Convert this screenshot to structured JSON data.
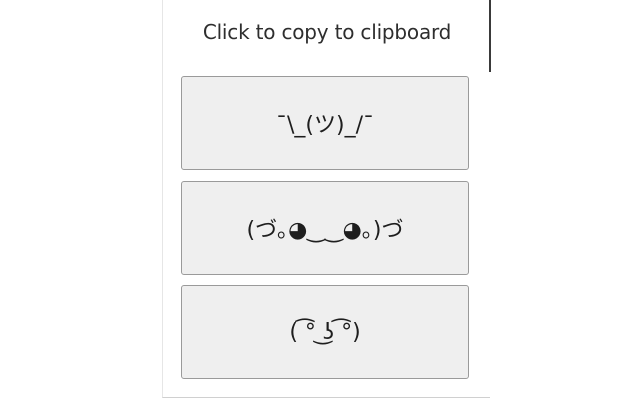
{
  "header": {
    "title": "Click to copy to clipboard"
  },
  "buttons": [
    {
      "label": "¯\\_(ツ)_/¯"
    },
    {
      "label": "(づ｡◕‿‿◕｡)づ"
    },
    {
      "label": "( ͡° ͜ʖ ͡°)"
    }
  ]
}
